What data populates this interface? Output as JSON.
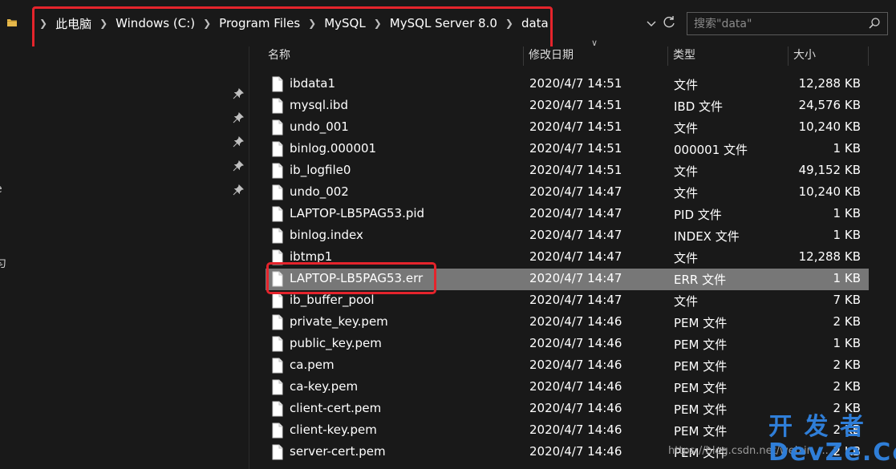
{
  "address_bar": {
    "crumbs": [
      "此电脑",
      "Windows (C:)",
      "Program Files",
      "MySQL",
      "MySQL Server 8.0",
      "data"
    ]
  },
  "search": {
    "placeholder": "搜索\"data\""
  },
  "nav": {
    "fragments": [
      "e",
      "匀"
    ]
  },
  "columns": {
    "name": "名称",
    "date": "修改日期",
    "type": "类型",
    "size": "大小"
  },
  "files": [
    {
      "name": "ibdata1",
      "date": "2020/4/7 14:51",
      "type": "文件",
      "size": "12,288 KB"
    },
    {
      "name": "mysql.ibd",
      "date": "2020/4/7 14:51",
      "type": "IBD 文件",
      "size": "24,576 KB"
    },
    {
      "name": "undo_001",
      "date": "2020/4/7 14:51",
      "type": "文件",
      "size": "10,240 KB"
    },
    {
      "name": "binlog.000001",
      "date": "2020/4/7 14:51",
      "type": "000001 文件",
      "size": "1 KB"
    },
    {
      "name": "ib_logfile0",
      "date": "2020/4/7 14:51",
      "type": "文件",
      "size": "49,152 KB"
    },
    {
      "name": "undo_002",
      "date": "2020/4/7 14:47",
      "type": "文件",
      "size": "10,240 KB"
    },
    {
      "name": "LAPTOP-LB5PAG53.pid",
      "date": "2020/4/7 14:47",
      "type": "PID 文件",
      "size": "1 KB"
    },
    {
      "name": "binlog.index",
      "date": "2020/4/7 14:47",
      "type": "INDEX 文件",
      "size": "1 KB"
    },
    {
      "name": "ibtmp1",
      "date": "2020/4/7 14:47",
      "type": "文件",
      "size": "12,288 KB"
    },
    {
      "name": "LAPTOP-LB5PAG53.err",
      "date": "2020/4/7 14:47",
      "type": "ERR 文件",
      "size": "1 KB",
      "selected": true
    },
    {
      "name": "ib_buffer_pool",
      "date": "2020/4/7 14:47",
      "type": "文件",
      "size": "7 KB"
    },
    {
      "name": "private_key.pem",
      "date": "2020/4/7 14:46",
      "type": "PEM 文件",
      "size": "2 KB"
    },
    {
      "name": "public_key.pem",
      "date": "2020/4/7 14:46",
      "type": "PEM 文件",
      "size": "1 KB"
    },
    {
      "name": "ca.pem",
      "date": "2020/4/7 14:46",
      "type": "PEM 文件",
      "size": "2 KB"
    },
    {
      "name": "ca-key.pem",
      "date": "2020/4/7 14:46",
      "type": "PEM 文件",
      "size": "2 KB"
    },
    {
      "name": "client-cert.pem",
      "date": "2020/4/7 14:46",
      "type": "PEM 文件",
      "size": "2 KB"
    },
    {
      "name": "client-key.pem",
      "date": "2020/4/7 14:46",
      "type": "PEM 文件",
      "size": "2 KB"
    },
    {
      "name": "server-cert.pem",
      "date": "2020/4/7 14:46",
      "type": "PEM 文件",
      "size": "2 KB"
    }
  ],
  "watermark": {
    "url": "https://blog.csdn.net/weixin_...",
    "logo_top": "开 发 者",
    "logo_bottom": "DevZe.CoM"
  },
  "colors": {
    "background": "#191919",
    "selection": "#777777",
    "annotation": "#e5242c",
    "folder": "#e6b84a",
    "logo": "#2f7ed8"
  }
}
